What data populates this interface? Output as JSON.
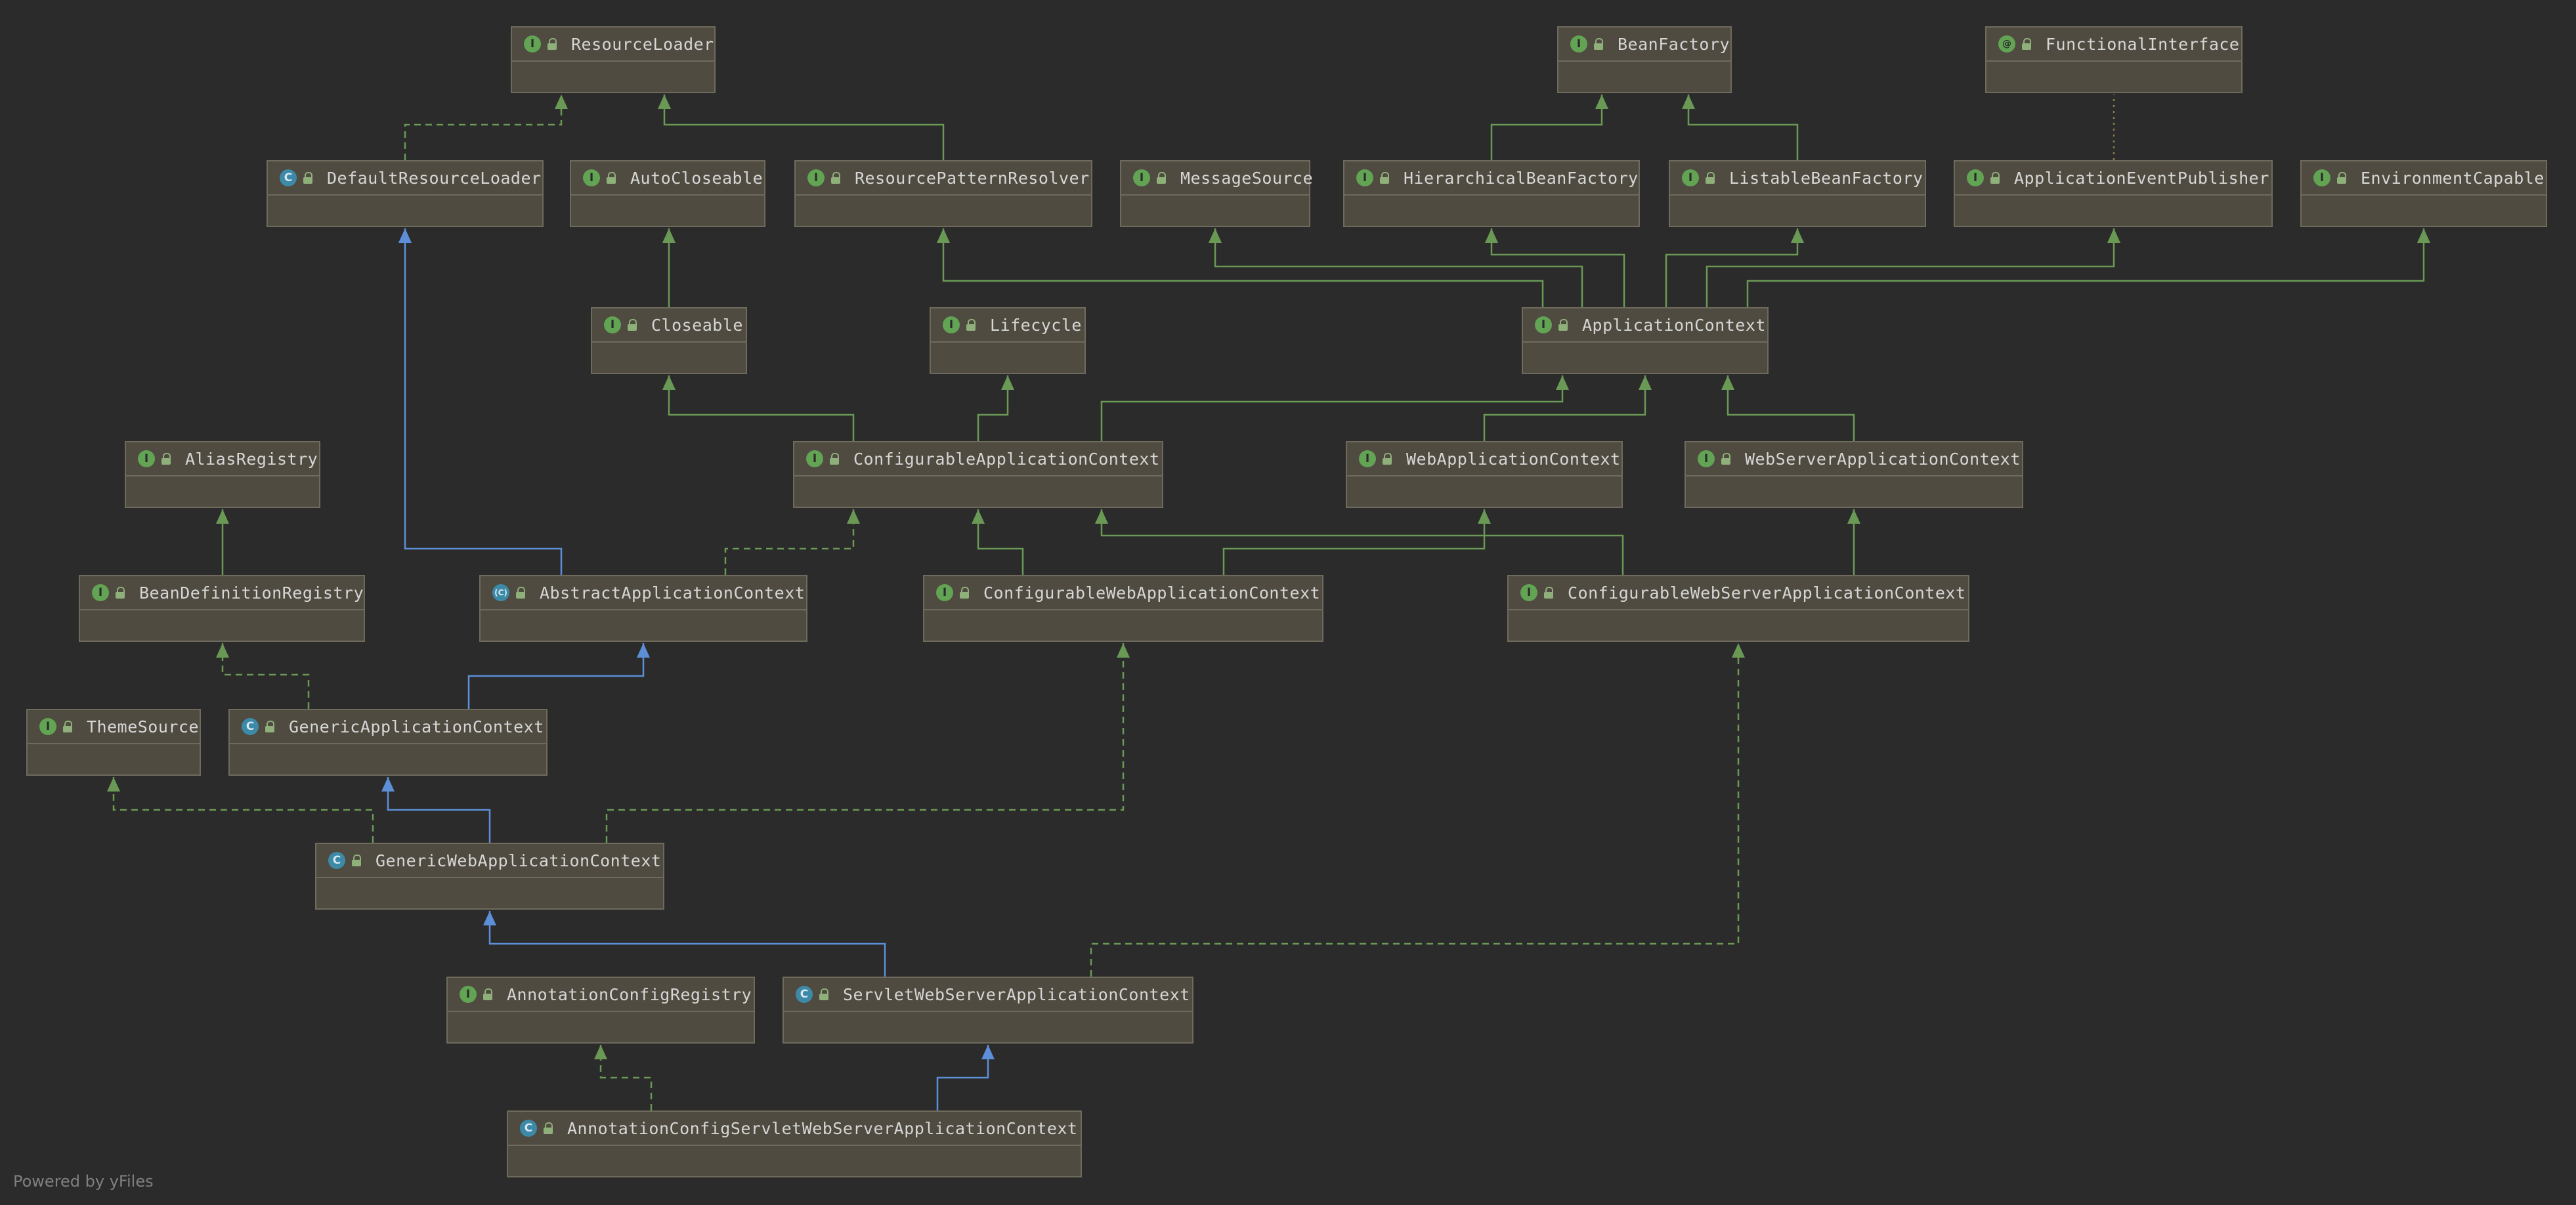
{
  "footer": "Powered by yFiles",
  "colors": {
    "background": "#2b2b2b",
    "node_fill": "#4f4b40",
    "node_border": "#6e6a5c",
    "interface_badge": "#62a354",
    "class_badge": "#3d8aa8",
    "implements_edge": "#6a9955",
    "extends_class_edge": "#5d8fd8"
  },
  "nodes": [
    {
      "id": "ResourceLoader",
      "kind": "interface",
      "label": "ResourceLoader"
    },
    {
      "id": "BeanFactory",
      "kind": "interface",
      "label": "BeanFactory"
    },
    {
      "id": "FunctionalInterface",
      "kind": "annotation",
      "label": "FunctionalInterface"
    },
    {
      "id": "DefaultResourceLoader",
      "kind": "class",
      "label": "DefaultResourceLoader"
    },
    {
      "id": "AutoCloseable",
      "kind": "interface",
      "label": "AutoCloseable"
    },
    {
      "id": "ResourcePatternResolver",
      "kind": "interface",
      "label": "ResourcePatternResolver"
    },
    {
      "id": "MessageSource",
      "kind": "interface",
      "label": "MessageSource"
    },
    {
      "id": "HierarchicalBeanFactory",
      "kind": "interface",
      "label": "HierarchicalBeanFactory"
    },
    {
      "id": "ListableBeanFactory",
      "kind": "interface",
      "label": "ListableBeanFactory"
    },
    {
      "id": "ApplicationEventPublisher",
      "kind": "interface",
      "label": "ApplicationEventPublisher"
    },
    {
      "id": "EnvironmentCapable",
      "kind": "interface",
      "label": "EnvironmentCapable"
    },
    {
      "id": "Closeable",
      "kind": "interface",
      "label": "Closeable"
    },
    {
      "id": "Lifecycle",
      "kind": "interface",
      "label": "Lifecycle"
    },
    {
      "id": "ApplicationContext",
      "kind": "interface",
      "label": "ApplicationContext"
    },
    {
      "id": "AliasRegistry",
      "kind": "interface",
      "label": "AliasRegistry"
    },
    {
      "id": "ConfigurableApplicationContext",
      "kind": "interface",
      "label": "ConfigurableApplicationContext"
    },
    {
      "id": "WebApplicationContext",
      "kind": "interface",
      "label": "WebApplicationContext"
    },
    {
      "id": "WebServerApplicationContext",
      "kind": "interface",
      "label": "WebServerApplicationContext"
    },
    {
      "id": "BeanDefinitionRegistry",
      "kind": "interface",
      "label": "BeanDefinitionRegistry"
    },
    {
      "id": "AbstractApplicationContext",
      "kind": "abstract",
      "label": "AbstractApplicationContext"
    },
    {
      "id": "ConfigurableWebApplicationContext",
      "kind": "interface",
      "label": "ConfigurableWebApplicationContext"
    },
    {
      "id": "ConfigurableWebServerApplicationContext",
      "kind": "interface",
      "label": "ConfigurableWebServerApplicationContext"
    },
    {
      "id": "ThemeSource",
      "kind": "interface",
      "label": "ThemeSource"
    },
    {
      "id": "GenericApplicationContext",
      "kind": "class",
      "label": "GenericApplicationContext"
    },
    {
      "id": "GenericWebApplicationContext",
      "kind": "class",
      "label": "GenericWebApplicationContext"
    },
    {
      "id": "AnnotationConfigRegistry",
      "kind": "interface",
      "label": "AnnotationConfigRegistry"
    },
    {
      "id": "ServletWebServerApplicationContext",
      "kind": "class",
      "label": "ServletWebServerApplicationContext"
    },
    {
      "id": "AnnotationConfigServletWebServerApplicationContext",
      "kind": "class",
      "label": "AnnotationConfigServletWebServerApplicationContext"
    }
  ],
  "edges": [
    {
      "from": "DefaultResourceLoader",
      "to": "ResourceLoader",
      "type": "implements"
    },
    {
      "from": "ResourcePatternResolver",
      "to": "ResourceLoader",
      "type": "extends-interface"
    },
    {
      "from": "HierarchicalBeanFactory",
      "to": "BeanFactory",
      "type": "extends-interface"
    },
    {
      "from": "ListableBeanFactory",
      "to": "BeanFactory",
      "type": "extends-interface"
    },
    {
      "from": "ApplicationEventPublisher",
      "to": "FunctionalInterface",
      "type": "annotated"
    },
    {
      "from": "Closeable",
      "to": "AutoCloseable",
      "type": "extends-interface"
    },
    {
      "from": "ApplicationContext",
      "to": "ResourcePatternResolver",
      "type": "extends-interface"
    },
    {
      "from": "ApplicationContext",
      "to": "MessageSource",
      "type": "extends-interface"
    },
    {
      "from": "ApplicationContext",
      "to": "HierarchicalBeanFactory",
      "type": "extends-interface"
    },
    {
      "from": "ApplicationContext",
      "to": "ListableBeanFactory",
      "type": "extends-interface"
    },
    {
      "from": "ApplicationContext",
      "to": "ApplicationEventPublisher",
      "type": "extends-interface"
    },
    {
      "from": "ApplicationContext",
      "to": "EnvironmentCapable",
      "type": "extends-interface"
    },
    {
      "from": "ConfigurableApplicationContext",
      "to": "Closeable",
      "type": "extends-interface"
    },
    {
      "from": "ConfigurableApplicationContext",
      "to": "Lifecycle",
      "type": "extends-interface"
    },
    {
      "from": "ConfigurableApplicationContext",
      "to": "ApplicationContext",
      "type": "extends-interface"
    },
    {
      "from": "WebApplicationContext",
      "to": "ApplicationContext",
      "type": "extends-interface"
    },
    {
      "from": "WebServerApplicationContext",
      "to": "ApplicationContext",
      "type": "extends-interface"
    },
    {
      "from": "BeanDefinitionRegistry",
      "to": "AliasRegistry",
      "type": "extends-interface"
    },
    {
      "from": "AbstractApplicationContext",
      "to": "DefaultResourceLoader",
      "type": "extends-class"
    },
    {
      "from": "AbstractApplicationContext",
      "to": "ConfigurableApplicationContext",
      "type": "implements"
    },
    {
      "from": "ConfigurableWebApplicationContext",
      "to": "ConfigurableApplicationContext",
      "type": "extends-interface"
    },
    {
      "from": "ConfigurableWebApplicationContext",
      "to": "WebApplicationContext",
      "type": "extends-interface"
    },
    {
      "from": "ConfigurableWebServerApplicationContext",
      "to": "ConfigurableApplicationContext",
      "type": "extends-interface"
    },
    {
      "from": "ConfigurableWebServerApplicationContext",
      "to": "WebServerApplicationContext",
      "type": "extends-interface"
    },
    {
      "from": "GenericApplicationContext",
      "to": "BeanDefinitionRegistry",
      "type": "implements"
    },
    {
      "from": "GenericApplicationContext",
      "to": "AbstractApplicationContext",
      "type": "extends-class"
    },
    {
      "from": "GenericWebApplicationContext",
      "to": "ThemeSource",
      "type": "implements"
    },
    {
      "from": "GenericWebApplicationContext",
      "to": "GenericApplicationContext",
      "type": "extends-class"
    },
    {
      "from": "GenericWebApplicationContext",
      "to": "ConfigurableWebApplicationContext",
      "type": "implements"
    },
    {
      "from": "ServletWebServerApplicationContext",
      "to": "GenericWebApplicationContext",
      "type": "extends-class"
    },
    {
      "from": "ServletWebServerApplicationContext",
      "to": "ConfigurableWebServerApplicationContext",
      "type": "implements"
    },
    {
      "from": "AnnotationConfigServletWebServerApplicationContext",
      "to": "AnnotationConfigRegistry",
      "type": "implements"
    },
    {
      "from": "AnnotationConfigServletWebServerApplicationContext",
      "to": "ServletWebServerApplicationContext",
      "type": "extends-class"
    }
  ]
}
